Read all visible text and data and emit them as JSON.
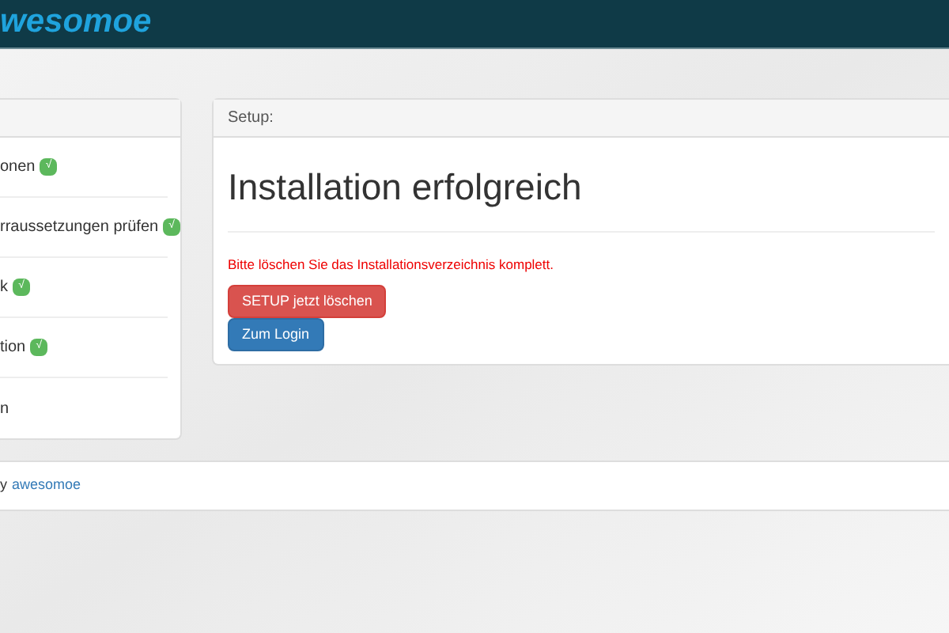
{
  "header": {
    "logo": "wesomoe"
  },
  "sidebar": {
    "items": [
      {
        "label": "onen",
        "done": true
      },
      {
        "label": "rraussetzungen prüfen",
        "done": true
      },
      {
        "label": "k",
        "done": true
      },
      {
        "label": "tion",
        "done": true
      },
      {
        "label": "n",
        "done": false
      }
    ],
    "check": "√"
  },
  "main": {
    "panel_title": "Setup:",
    "heading": "Installation erfolgreich",
    "warning": "Bitte löschen Sie das Installationsverzeichnis komplett.",
    "buttons": [
      {
        "label": "SETUP jetzt löschen",
        "kind": "danger"
      },
      {
        "label": "Zum Login",
        "kind": "primary"
      }
    ]
  },
  "footer": {
    "prefix": "y",
    "link": "awesomoe"
  }
}
